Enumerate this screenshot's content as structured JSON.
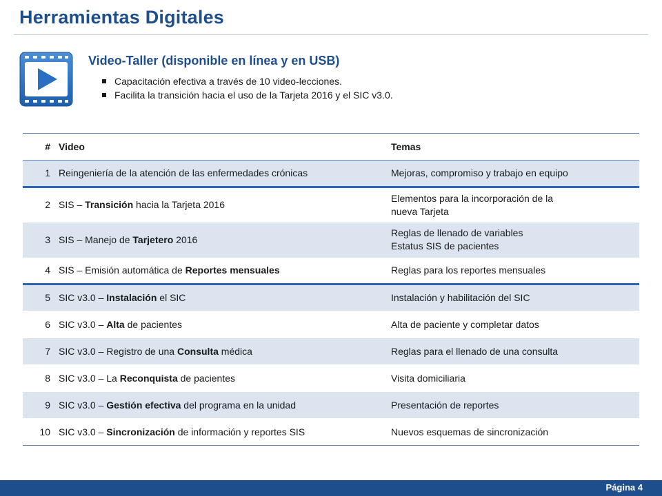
{
  "header": {
    "title": "Herramientas Digitales"
  },
  "intro": {
    "heading": "Video-Taller (disponible en línea y en USB)",
    "bullets": [
      "Capacitación efectiva a través de 10 video-lecciones.",
      "Facilita la transición hacia el uso de la Tarjeta 2016 y el SIC v3.0."
    ]
  },
  "table": {
    "headers": {
      "num": "#",
      "video": "Video",
      "topics": "Temas"
    },
    "rows": [
      {
        "num": "1",
        "video": [
          {
            "t": "Reingeniería de la atención de las enfermedades crónicas",
            "b": false
          }
        ],
        "topics": [
          "Mejoras, compromiso y trabajo en equipo"
        ]
      },
      {
        "num": "2",
        "video": [
          {
            "t": "SIS – ",
            "b": false
          },
          {
            "t": "Transición",
            "b": true
          },
          {
            "t": " hacia la Tarjeta 2016",
            "b": false
          }
        ],
        "topics": [
          "Elementos para la incorporación de la",
          "nueva Tarjeta"
        ]
      },
      {
        "num": "3",
        "video": [
          {
            "t": "SIS – Manejo de ",
            "b": false
          },
          {
            "t": "Tarjetero",
            "b": true
          },
          {
            "t": " 2016",
            "b": false
          }
        ],
        "topics": [
          "Reglas de llenado de variables",
          "Estatus SIS de pacientes"
        ]
      },
      {
        "num": "4",
        "video": [
          {
            "t": "SIS – Emisión automática de ",
            "b": false
          },
          {
            "t": "Reportes mensuales",
            "b": true
          }
        ],
        "topics": [
          "Reglas para los reportes mensuales"
        ]
      },
      {
        "num": "5",
        "video": [
          {
            "t": "SIC v3.0 – ",
            "b": false
          },
          {
            "t": "Instalación",
            "b": true
          },
          {
            "t": " el SIC",
            "b": false
          }
        ],
        "topics": [
          "Instalación y habilitación del SIC"
        ]
      },
      {
        "num": "6",
        "video": [
          {
            "t": "SIC v3.0 – ",
            "b": false
          },
          {
            "t": "Alta",
            "b": true
          },
          {
            "t": " de pacientes",
            "b": false
          }
        ],
        "topics": [
          "Alta de paciente y completar datos"
        ]
      },
      {
        "num": "7",
        "video": [
          {
            "t": "SIC v3.0 – Registro de una ",
            "b": false
          },
          {
            "t": "Consulta",
            "b": true
          },
          {
            "t": " médica",
            "b": false
          }
        ],
        "topics": [
          "Reglas para el llenado de una consulta"
        ]
      },
      {
        "num": "8",
        "video": [
          {
            "t": "SIC v3.0 – La ",
            "b": false
          },
          {
            "t": "Reconquista",
            "b": true
          },
          {
            "t": " de pacientes",
            "b": false
          }
        ],
        "topics": [
          "Visita domiciliaria"
        ]
      },
      {
        "num": "9",
        "video": [
          {
            "t": "SIC v3.0 – ",
            "b": false
          },
          {
            "t": "Gestión efectiva",
            "b": true
          },
          {
            "t": " del programa en la unidad",
            "b": false
          }
        ],
        "topics": [
          "Presentación de reportes"
        ]
      },
      {
        "num": "10",
        "video": [
          {
            "t": "SIC v3.0 – ",
            "b": false
          },
          {
            "t": "Sincronización",
            "b": true
          },
          {
            "t": " de información y reportes SIS",
            "b": false
          }
        ],
        "topics": [
          "Nuevos esquemas de sincronización"
        ]
      }
    ]
  },
  "footer": {
    "page_label": "Página 4"
  },
  "icons": {
    "video": "video-play-icon"
  },
  "colors": {
    "brand_blue": "#1f4e8c",
    "row_shade": "#dce4f0",
    "rule_blue": "#2a66b8"
  }
}
